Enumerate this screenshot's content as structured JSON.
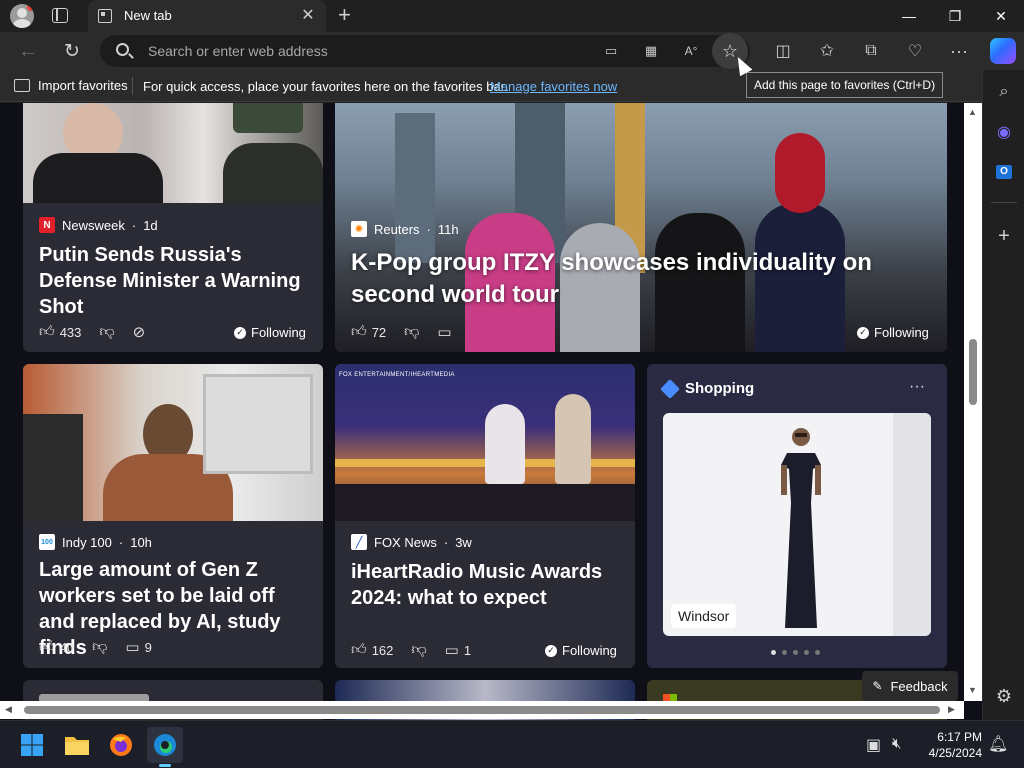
{
  "browser": {
    "tab_title": "New tab",
    "address_placeholder": "Search or enter web address"
  },
  "favorites_bar": {
    "import_label": "Import favorites",
    "message": "For quick access, place your favorites here on the favorites bar.",
    "manage_link": "Manage favorites now"
  },
  "tooltip": "Add this page to favorites (Ctrl+D)",
  "cards": [
    {
      "source": "Newsweek",
      "age": "1d",
      "headline": "Putin Sends Russia's Defense Minister a Warning Shot",
      "likes": "433",
      "following": "Following"
    },
    {
      "source": "Reuters",
      "age": "11h",
      "headline": "K-Pop group ITZY showcases individuality on second world tour",
      "likes": "72",
      "following": "Following"
    },
    {
      "source": "Indy 100",
      "age": "10h",
      "headline": "Large amount of Gen Z workers set to be laid off and replaced by AI, study finds",
      "likes": "40",
      "comments": "9"
    },
    {
      "source": "FOX News",
      "age": "3w",
      "headline": "iHeartRadio Music Awards 2024: what to expect",
      "likes": "162",
      "comments": "1",
      "following": "Following",
      "photo_caption": "FOX ENTERTAINMENT/IHEARTMEDIA"
    }
  ],
  "shopping": {
    "title": "Shopping",
    "more": "···",
    "product_label": "Windsor"
  },
  "feedback_label": "Feedback",
  "taskbar": {
    "time": "6:17 PM",
    "date": "4/25/2024"
  },
  "colors": {
    "accent_link": "#6cb8ff",
    "newsweek_logo": "#e0202a",
    "reuters_logo": "#ff8000",
    "fox_logo": "#2050c8"
  }
}
